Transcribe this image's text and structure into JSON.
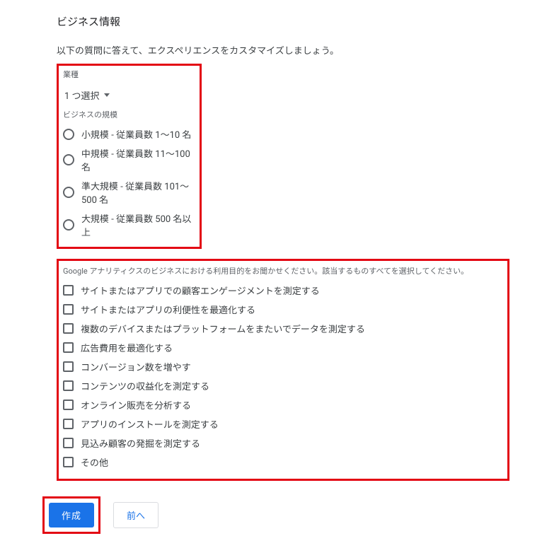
{
  "section_title": "ビジネス情報",
  "intro": "以下の質問に答えて、エクスペリエンスをカスタマイズしましょう。",
  "industry": {
    "label": "業種",
    "dropdown_text": "1 つ選択"
  },
  "size": {
    "label": "ビジネスの規模",
    "options": [
      "小規模 - 従業員数 1～10 名",
      "中規模 - 従業員数 11～100 名",
      "準大規模 - 従業員数 101～500 名",
      "大規模 - 従業員数 500 名以上"
    ]
  },
  "usage": {
    "label": "Google アナリティクスのビジネスにおける利用目的をお聞かせください。該当するものすべてを選択してください。",
    "options": [
      "サイトまたはアプリでの顧客エンゲージメントを測定する",
      "サイトまたはアプリの利便性を最適化する",
      "複数のデバイスまたはプラットフォームをまたいでデータを測定する",
      "広告費用を最適化する",
      "コンバージョン数を増やす",
      "コンテンツの収益化を測定する",
      "オンライン販売を分析する",
      "アプリのインストールを測定する",
      "見込み顧客の発掘を測定する",
      "その他"
    ]
  },
  "buttons": {
    "create": "作成",
    "back": "前へ"
  }
}
